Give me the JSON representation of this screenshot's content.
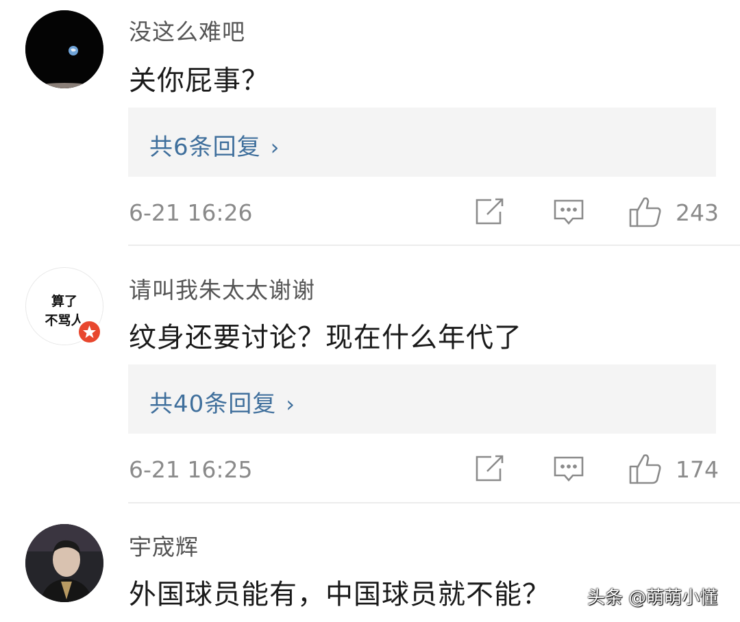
{
  "comments": [
    {
      "username": "没这么难吧",
      "content": "关你屁事？",
      "replies_label": "共6条回复",
      "time": "6-21 16:26",
      "likes": "243",
      "avatar": "earth-from-space"
    },
    {
      "username": "请叫我朱太太谢谢",
      "content": "纹身还要讨论？现在什么年代了",
      "replies_label": "共40条回复",
      "time": "6-21 16:25",
      "likes": "174",
      "avatar": "text-avatar",
      "avatar_text_line1": "算了",
      "avatar_text_line2": "不骂人"
    },
    {
      "username": "宇宬辉",
      "content": "外国球员能有，中国球员就不能？",
      "avatar": "portrait-photo"
    }
  ],
  "icons": {
    "share": "share-icon",
    "reply": "comment-icon",
    "like": "thumbs-up-icon",
    "chevron": "chevron-right-icon",
    "badge": "verified-star-badge"
  },
  "watermark": "头条 @萌萌小懂",
  "colors": {
    "link": "#3f6f9c",
    "meta": "#8a8a8a",
    "reply_bg": "#f4f4f4",
    "badge": "#e8472e"
  }
}
